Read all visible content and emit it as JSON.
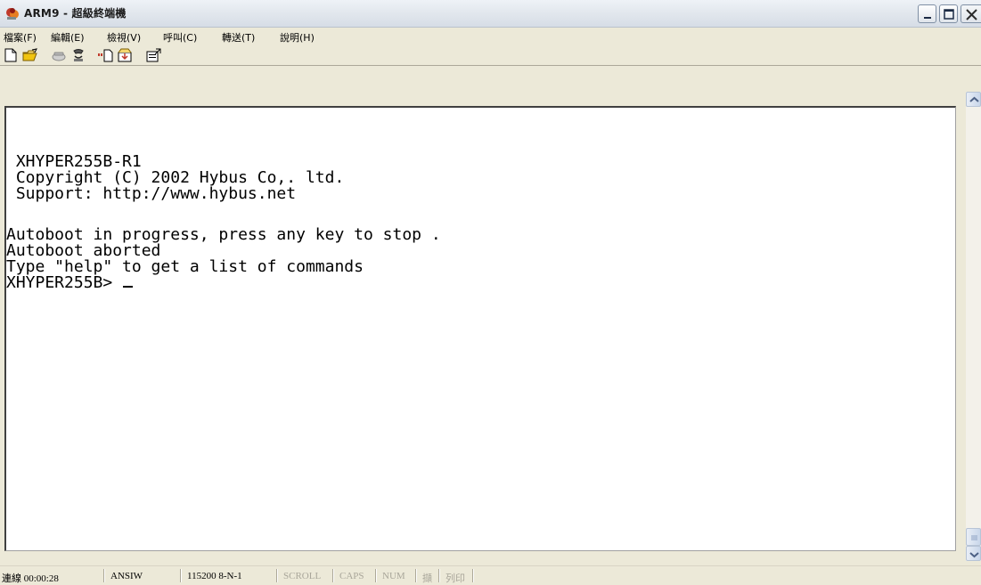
{
  "window": {
    "title": "ARM9 - 超級終端機"
  },
  "menu": {
    "items": [
      {
        "label": "檔案(F)"
      },
      {
        "label": "編輯(E)"
      },
      {
        "label": "檢視(V)"
      },
      {
        "label": "呼叫(C)"
      },
      {
        "label": "轉送(T)"
      },
      {
        "label": "說明(H)"
      }
    ]
  },
  "toolbar": {
    "buttons": [
      {
        "icon": "new-document-icon"
      },
      {
        "icon": "open-folder-icon"
      },
      {
        "icon": "call-phone-icon"
      },
      {
        "icon": "hang-up-icon"
      },
      {
        "icon": "send-file-icon"
      },
      {
        "icon": "receive-file-icon"
      },
      {
        "icon": "properties-icon"
      }
    ]
  },
  "terminal": {
    "lines": [
      " XHYPER255B-R1",
      " Copyright (C) 2002 Hybus Co,. ltd.",
      " Support: http://www.hybus.net",
      "Autoboot in progress, press any key to stop .",
      "Autoboot aborted",
      "Type \"help\" to get a list of commands",
      "XHYPER255B> "
    ],
    "background": "#ffffff",
    "foreground": "#000000"
  },
  "status": {
    "connection": "連線 00:00:28",
    "emulation": "ANSIW",
    "port_settings": "115200 8-N-1",
    "scroll": "SCROLL",
    "caps": "CAPS",
    "num": "NUM",
    "capture": "擷",
    "print": "列印"
  }
}
